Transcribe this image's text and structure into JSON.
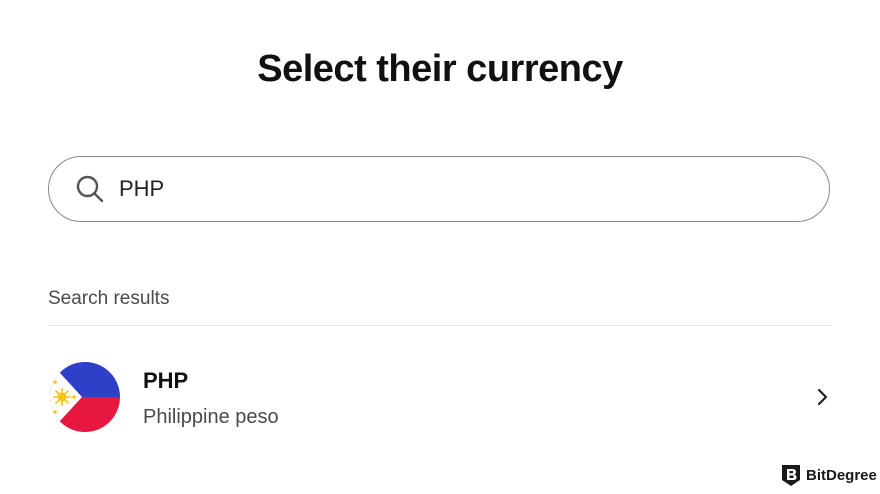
{
  "header": {
    "title": "Select their currency"
  },
  "search": {
    "value": "PHP",
    "icon": "search-icon"
  },
  "results": {
    "section_label": "Search results",
    "items": [
      {
        "code": "PHP",
        "name": "Philippine peso",
        "flag": "philippines-flag-icon"
      }
    ]
  },
  "watermark": {
    "text": "BitDegree"
  },
  "colors": {
    "flag_blue": "#2e3fc8",
    "flag_red": "#e8173f",
    "flag_sun": "#f5c518",
    "border": "#8a8a8a",
    "divider": "#e6e6e6"
  }
}
